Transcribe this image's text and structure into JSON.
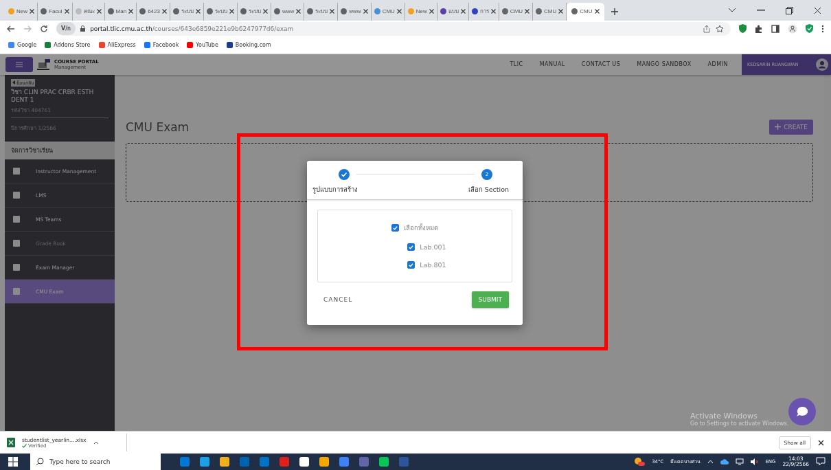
{
  "browser": {
    "tabs": [
      {
        "title": "New",
        "selected": false
      },
      {
        "title": "Facul",
        "selected": false
      },
      {
        "title": "คณะ",
        "selected": false
      },
      {
        "title": "Man",
        "selected": false
      },
      {
        "title": "6423",
        "selected": false
      },
      {
        "title": "ระบบ",
        "selected": false
      },
      {
        "title": "ระบบ",
        "selected": false
      },
      {
        "title": "ระบบ",
        "selected": false
      },
      {
        "title": "www",
        "selected": false
      },
      {
        "title": "ระบบ",
        "selected": false
      },
      {
        "title": "www",
        "selected": false
      },
      {
        "title": "CMU",
        "selected": false
      },
      {
        "title": "New",
        "selected": false
      },
      {
        "title": "แบบ",
        "selected": false
      },
      {
        "title": "การ",
        "selected": false
      },
      {
        "title": "CMU",
        "selected": false
      },
      {
        "title": "CMU",
        "selected": false
      },
      {
        "title": "CMU",
        "selected": true
      }
    ],
    "translate_badge": "V/ก",
    "url_host": "portal.tlic.cmu.ac.th",
    "url_path": "/courses/643e6859e221e9b6247977d6/exam",
    "bookmarks": [
      "Google",
      "Addons Store",
      "AliExpress",
      "Facebook",
      "YouTube",
      "Booking.com"
    ]
  },
  "header": {
    "logo_title": "COURSE PORTAL",
    "logo_subtitle": "Management",
    "nav": [
      "TLIC",
      "MANUAL",
      "CONTACT US",
      "MANGO SANDBOX",
      "ADMIN"
    ],
    "user_name": "KEDSARIN RUANGWAN"
  },
  "sidebar": {
    "back_link": "ย้อนกลับ",
    "course_name": "วิชา CLIN PRAC CRBR ESTH DENT 1",
    "course_code": "รหัสวิชา 404761",
    "term": "ปีการศึกษา 1/2566",
    "section_title": "จัดการวิชาเรียน",
    "items": [
      {
        "label": "Instructor Management",
        "selected": false,
        "disabled": false
      },
      {
        "label": "LMS",
        "selected": false,
        "disabled": false
      },
      {
        "label": "MS Teams",
        "selected": false,
        "disabled": false
      },
      {
        "label": "Grade Book",
        "selected": false,
        "disabled": true
      },
      {
        "label": "Exam Manager",
        "selected": false,
        "disabled": false
      },
      {
        "label": "CMU Exam",
        "selected": true,
        "disabled": false
      }
    ]
  },
  "content": {
    "title": "CMU Exam",
    "create_button": "CREATE"
  },
  "dialog": {
    "steps": [
      {
        "label": "รูปแบบการสร้าง",
        "completed": true
      },
      {
        "label": "เลือก Section",
        "number": "2",
        "completed": false
      }
    ],
    "select_all": {
      "label": "เลือกทั้งหมด",
      "checked": true
    },
    "sections": [
      {
        "label": "Lab.001",
        "checked": true
      },
      {
        "label": "Lab.801",
        "checked": true
      }
    ],
    "cancel": "CANCEL",
    "submit": "SUBMIT"
  },
  "activation": {
    "title": "Activate Windows",
    "hint": "Go to Settings to activate Windows."
  },
  "download_bar": {
    "file_name": "studentlist_yearlin....xlsx",
    "status": "Verified",
    "show_all": "Show all"
  },
  "taskbar": {
    "search_placeholder": "Type here to search",
    "temperature": "34°C",
    "weather": "มีแดดบางส่วน",
    "language": "ENG",
    "time": "14:03",
    "date": "22/9/2566"
  }
}
